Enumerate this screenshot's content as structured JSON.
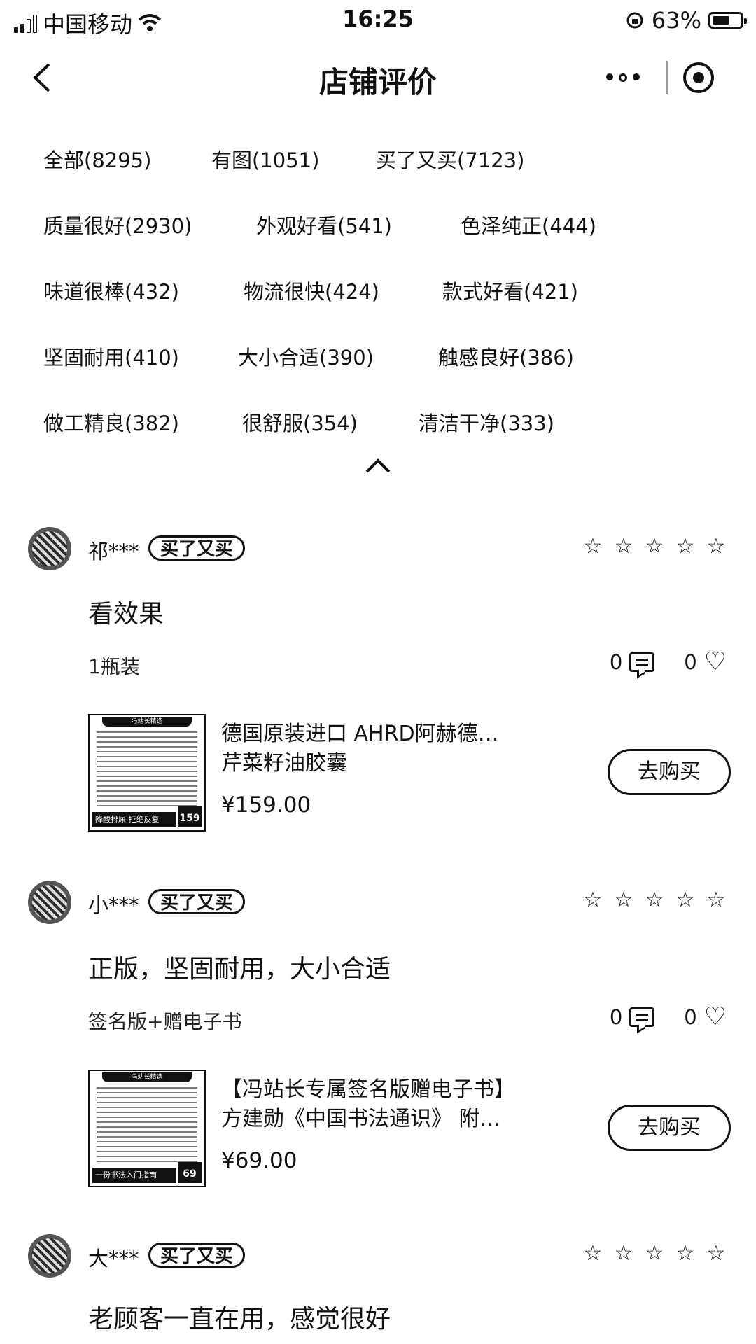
{
  "status_bar": {
    "carrier": "中国移动",
    "time": "16:25",
    "battery": "63%",
    "battery_level": 0.63
  },
  "header": {
    "title": "店铺评价"
  },
  "tag_rows": [
    [
      "全部(8295)",
      "有图(1051)",
      "买了又买(7123)"
    ],
    [
      "质量很好(2930)",
      "外观好看(541)",
      "色泽纯正(444)"
    ],
    [
      "味道很棒(432)",
      "物流很快(424)",
      "款式好看(421)"
    ],
    [
      "坚固耐用(410)",
      "大小合适(390)",
      "触感良好(386)"
    ],
    [
      "做工精良(382)",
      "很舒服(354)",
      "清洁干净(333)"
    ]
  ],
  "reviews": [
    {
      "user": "祁***",
      "badge": "买了又买",
      "text": "看效果",
      "spec": "1瓶装",
      "comments": "0",
      "likes": "0",
      "product": {
        "title_line1": "德国原装进口 AHRD阿赫德鲣鱼",
        "title_line2": "芹菜籽油胶囊",
        "price": "¥159.00",
        "thumb_header": "冯站长精选",
        "thumb_footer": "降酸排尿 拒绝反复",
        "thumb_price": "159",
        "buy_label": "去购买"
      }
    },
    {
      "user": "小***",
      "badge": "买了又买",
      "text": "正版，坚固耐用，大小合适",
      "spec": "签名版+赠电子书",
      "comments": "0",
      "likes": "0",
      "product": {
        "title_line1": "【冯站长专属签名版赠电子书】",
        "title_line2": "方建勋《中国书法通识》 附赠...",
        "price": "¥69.00",
        "thumb_header": "冯站长精选",
        "thumb_footer": "一份书法入门指南",
        "thumb_price": "69",
        "buy_label": "去购买"
      }
    },
    {
      "user": "大***",
      "badge": "买了又买",
      "text": "老顾客一直在用，感觉很好"
    }
  ]
}
